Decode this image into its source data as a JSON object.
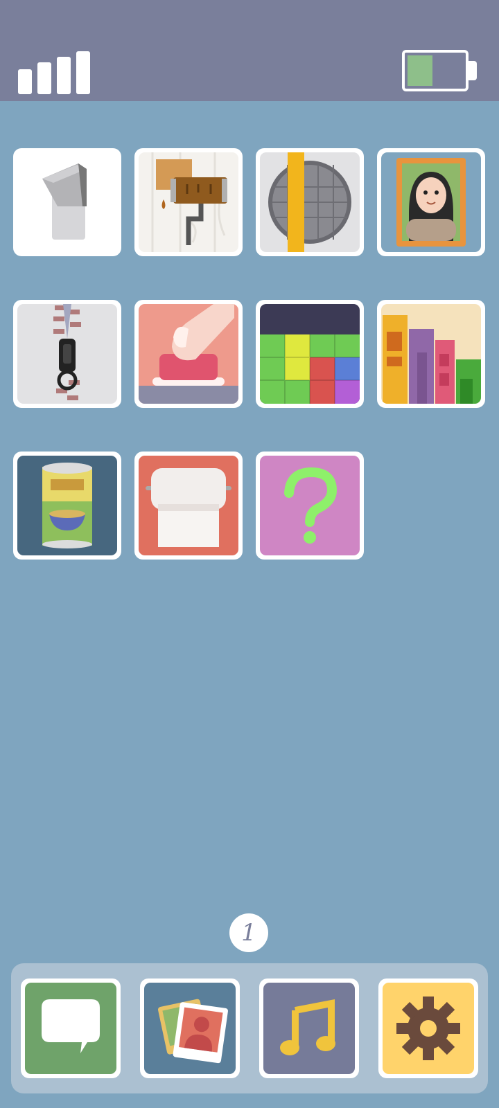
{
  "status_bar": {
    "signal_bars": 4,
    "battery_level": 0.45,
    "battery_color": "#8ebf8a"
  },
  "home": {
    "background_color": "#7fa5bf",
    "apps": [
      {
        "id": "light-switch",
        "icon": "light-switch-icon"
      },
      {
        "id": "paint-roller",
        "icon": "paint-roller-icon"
      },
      {
        "id": "manhole",
        "icon": "manhole-cover-icon"
      },
      {
        "id": "portrait",
        "icon": "portrait-painting-icon"
      },
      {
        "id": "zipper",
        "icon": "zipper-icon"
      },
      {
        "id": "push-button",
        "icon": "push-button-icon"
      },
      {
        "id": "blocks",
        "icon": "color-blocks-icon"
      },
      {
        "id": "bookshelf",
        "icon": "books-icon"
      },
      {
        "id": "soup-can",
        "icon": "soup-can-icon"
      },
      {
        "id": "toilet-paper",
        "icon": "toilet-paper-icon"
      },
      {
        "id": "mystery",
        "icon": "question-mark-icon"
      }
    ]
  },
  "page_indicator": {
    "current_page": "1"
  },
  "dock": {
    "apps": [
      {
        "id": "messages",
        "icon": "chat-bubble-icon",
        "color": "#6fa36a"
      },
      {
        "id": "photos",
        "icon": "photos-icon",
        "color": "#5a7f9a"
      },
      {
        "id": "music",
        "icon": "music-note-icon",
        "color": "#767b99"
      },
      {
        "id": "settings",
        "icon": "gear-icon",
        "color": "#ffd36b"
      }
    ]
  }
}
